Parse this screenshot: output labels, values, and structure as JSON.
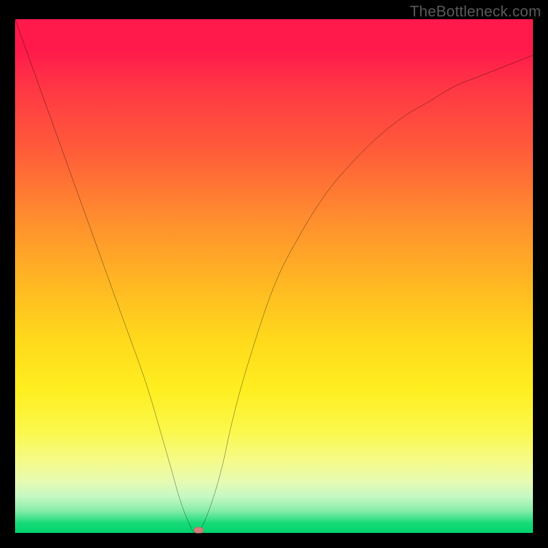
{
  "watermark": "TheBottleneck.com",
  "chart_data": {
    "type": "line",
    "title": "",
    "xlabel": "",
    "ylabel": "",
    "xlim": [
      0,
      100
    ],
    "ylim": [
      0,
      100
    ],
    "grid": false,
    "legend": false,
    "background_gradient_meaning": "bottleneck severity (top=high/red, bottom=low/green)",
    "series": [
      {
        "name": "bottleneck-curve",
        "color": "#000000",
        "x": [
          0,
          5,
          10,
          15,
          20,
          25,
          28,
          30,
          32,
          34,
          35,
          36,
          38,
          40,
          42,
          45,
          50,
          55,
          60,
          65,
          70,
          75,
          80,
          85,
          90,
          95,
          100
        ],
        "values": [
          100,
          86,
          72,
          58,
          44,
          30,
          20,
          13,
          6,
          1,
          0,
          1,
          6,
          13,
          22,
          33,
          48,
          58,
          66,
          72,
          77,
          81,
          84,
          87,
          89,
          91,
          93
        ]
      }
    ],
    "annotations": [
      {
        "name": "min-marker",
        "x": 35.5,
        "y": 0.6,
        "color": "#d67b7b"
      }
    ]
  }
}
